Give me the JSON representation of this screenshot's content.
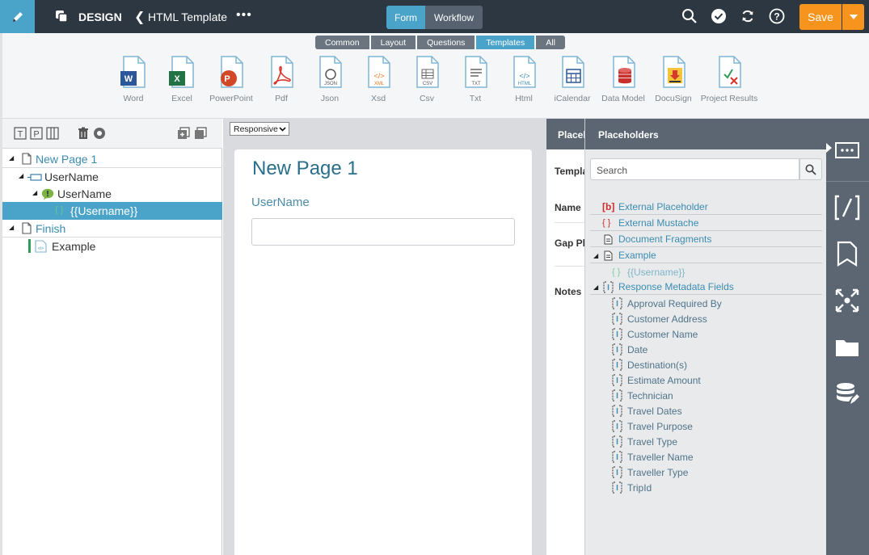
{
  "topbar": {
    "app_label": "DESIGN",
    "doc_title": "HTML Template",
    "more": "•••",
    "mode_tabs": [
      "Form",
      "Workflow"
    ],
    "save_label": "Save"
  },
  "ribbon": {
    "tabs": [
      "Common",
      "Layout",
      "Questions",
      "Templates",
      "All"
    ],
    "active_tab": "Templates",
    "tools": [
      "Word",
      "Excel",
      "PowerPoint",
      "Pdf",
      "Json",
      "Xsd",
      "Csv",
      "Txt",
      "Html",
      "iCalendar",
      "Data Model",
      "DocuSign",
      "Project Results"
    ],
    "tool_badges": [
      "W",
      "X",
      "P",
      "",
      "JSON",
      "XML",
      "CSV",
      "TXT",
      "HTML",
      "",
      "",
      "",
      ""
    ]
  },
  "tree": {
    "items": [
      {
        "label": "New Page 1"
      },
      {
        "label": "UserName"
      },
      {
        "label": "UserName"
      },
      {
        "label": "{{Username}}"
      },
      {
        "label": "Finish"
      },
      {
        "label": "Example"
      }
    ]
  },
  "canvas": {
    "view_mode": "Responsive",
    "page_title": "New Page 1",
    "field_label": "UserName",
    "field_value": ""
  },
  "props": {
    "header": "Placeholders",
    "labels": [
      "Template",
      "Name",
      "Gap Placeholders",
      "Notes"
    ]
  },
  "placeholders": {
    "header": "Placeholders",
    "search_placeholder": "Search",
    "groups": [
      {
        "icon": "[b]",
        "label": "External Placeholder"
      },
      {
        "icon": "{ }",
        "label": "External Mustache"
      },
      {
        "icon": "",
        "label": "Document Fragments"
      },
      {
        "icon": "",
        "label": "Example"
      },
      {
        "icon": "{ }",
        "label": "{{Username}}"
      },
      {
        "icon": "",
        "label": "Response Metadata Fields"
      }
    ],
    "metadata_fields": [
      "Approval Required By",
      "Customer Address",
      "Customer Name",
      "Date",
      "Destination(s)",
      "Estimate Amount",
      "Technician",
      "Travel Dates",
      "Travel Purpose",
      "Travel Type",
      "Traveller Name",
      "Traveller Type",
      "TripId"
    ]
  },
  "colors": {
    "accent": "#4aa3c8",
    "topbar": "#2d3741",
    "save": "#f7941d",
    "link": "#3a8cb0"
  }
}
